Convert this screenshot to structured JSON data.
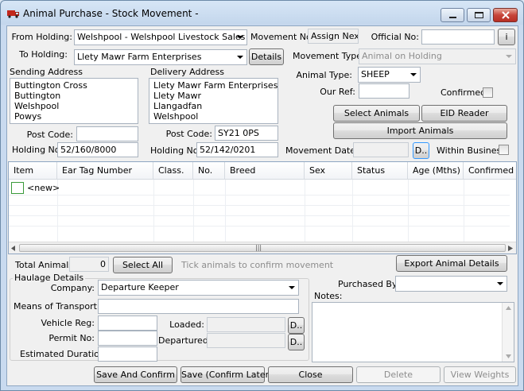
{
  "window": {
    "title": "Animal Purchase - Stock Movement -",
    "icon": "truck-icon"
  },
  "header": {
    "from_holding_label": "From Holding:",
    "from_holding_value": "Welshpool - Welshpool Livestock Sales",
    "to_holding_label": "To Holding:",
    "to_holding_value": "Llety Mawr Farm Enterprises",
    "details_button": "Details",
    "movement_no_label": "Movement No:",
    "assign_next_label": "Assign Next",
    "official_no_label": "Official No:",
    "official_no_value": "",
    "info_button": "i",
    "movement_type_label": "Movement Type:",
    "movement_type_value": "Animal on Holding"
  },
  "sending": {
    "label": "Sending Address",
    "address": "Buttington Cross\nButtington\nWelshpool\nPowys",
    "postcode_label": "Post Code:",
    "postcode_value": "",
    "holding_no_label": "Holding No:",
    "holding_no_value": "52/160/8000"
  },
  "delivery": {
    "label": "Delivery Address",
    "address": "Llety Mawr Farm Enterprises\nLlety Mawr\nLlangadfan\nWelshpool",
    "postcode_label": "Post Code:",
    "postcode_value": "SY21 0PS",
    "holding_no_label": "Holding No:",
    "holding_no_value": "52/142/0201"
  },
  "animal": {
    "type_label": "Animal Type:",
    "type_value": "SHEEP",
    "our_ref_label": "Our Ref:",
    "our_ref_value": "",
    "confirmed_label": "Confirmed:",
    "confirmed": false,
    "select_animals_button": "Select Animals",
    "eid_reader_button": "EID Reader",
    "import_animals_button": "Import Animals",
    "movement_date_label": "Movement Date:",
    "movement_date_value": "",
    "date_button": "D..",
    "within_business_label": "Within Business",
    "within_business": false
  },
  "grid": {
    "columns": [
      "Item",
      "Ear Tag Number",
      "Class.",
      "No.",
      "Breed",
      "Sex",
      "Status",
      "Age (Mths)",
      "Confirmed"
    ],
    "new_row_label": "<new>",
    "scroll_grip": "|||"
  },
  "totals": {
    "total_label": "Total Animals:",
    "total_value": "0",
    "select_all_button": "Select All",
    "hint": "Tick animals to confirm movement",
    "export_button": "Export Animal Details"
  },
  "haulage": {
    "legend": "Haulage Details",
    "company_label": "Company:",
    "company_value": "Departure Keeper",
    "transport_label": "Means of Transport:",
    "transport_value": "",
    "vehicle_reg_label": "Vehicle Reg:",
    "vehicle_reg_value": "",
    "permit_no_label": "Permit No:",
    "permit_no_value": "",
    "duration_label": "Estimated Duration:",
    "duration_value": "",
    "loaded_label": "Loaded:",
    "loaded_value": "",
    "departured_label": "Departured:",
    "departured_value": "",
    "date_button": "D.."
  },
  "purchase": {
    "purchased_by_label": "Purchased By:",
    "purchased_by_value": "",
    "notes_label": "Notes:",
    "notes_value": ""
  },
  "footer": {
    "save_confirm": "Save And Confirm",
    "save_confirm_later": "Save (Confirm Later)",
    "close": "Close",
    "delete": "Delete",
    "view_weights": "View Weights"
  },
  "colors": {
    "accent": "#3399ff",
    "new_row_box": "#3a9a3a",
    "close_button": "#c7453a"
  }
}
